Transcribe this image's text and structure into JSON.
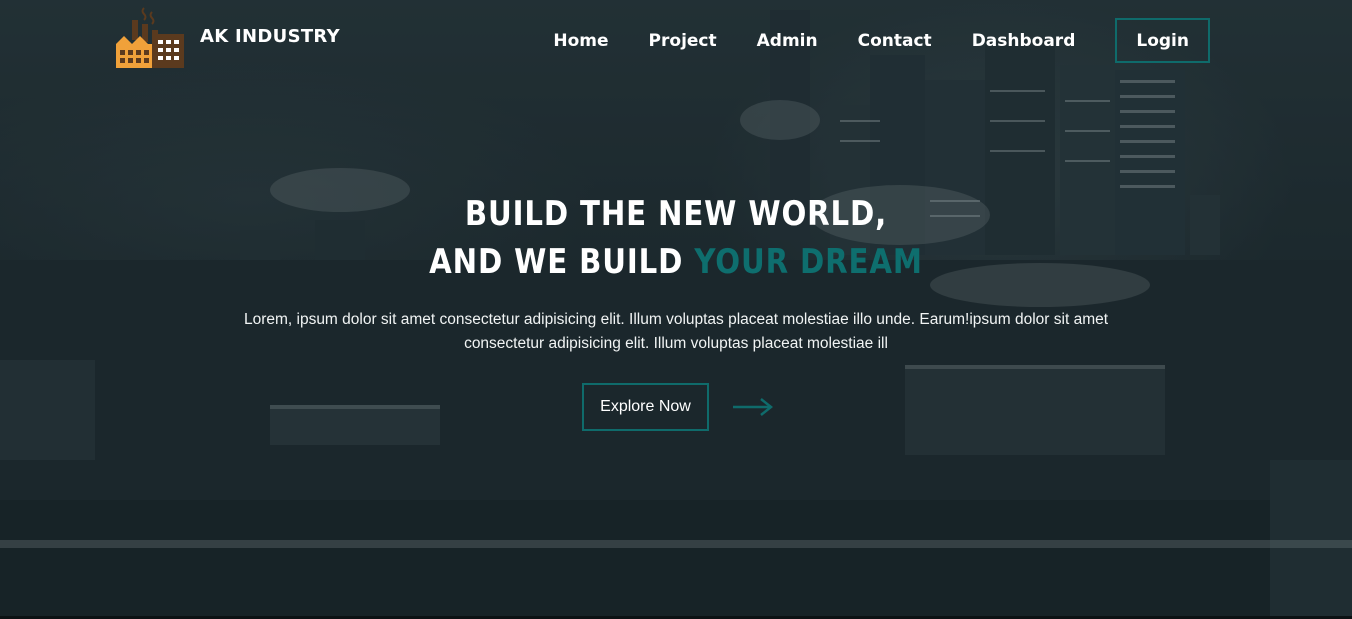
{
  "brand": {
    "name": "AK INDUSTRY",
    "logo_icon": "factory-icon"
  },
  "nav": {
    "items": [
      {
        "label": "Home"
      },
      {
        "label": "Project"
      },
      {
        "label": "Admin"
      },
      {
        "label": "Contact"
      },
      {
        "label": "Dashboard"
      }
    ],
    "login_label": "Login"
  },
  "hero": {
    "headline_line1": "BUILD THE NEW WORLD,",
    "headline_line2_prefix": "AND WE BUILD",
    "headline_line2_accent": "YOUR DREAM",
    "description": "Lorem, ipsum dolor sit amet consectetur adipisicing elit. Illum voluptas placeat molestiae illo unde. Earum!ipsum dolor sit amet consectetur adipisicing elit. Illum voluptas placeat molestiae ill",
    "cta_label": "Explore Now",
    "cta_icon": "arrow-right-icon"
  },
  "colors": {
    "accent": "#0e6e6e",
    "button_border": "#0f6b6b",
    "logo_orange": "#f0a13a",
    "logo_brown": "#5b3a1e"
  }
}
